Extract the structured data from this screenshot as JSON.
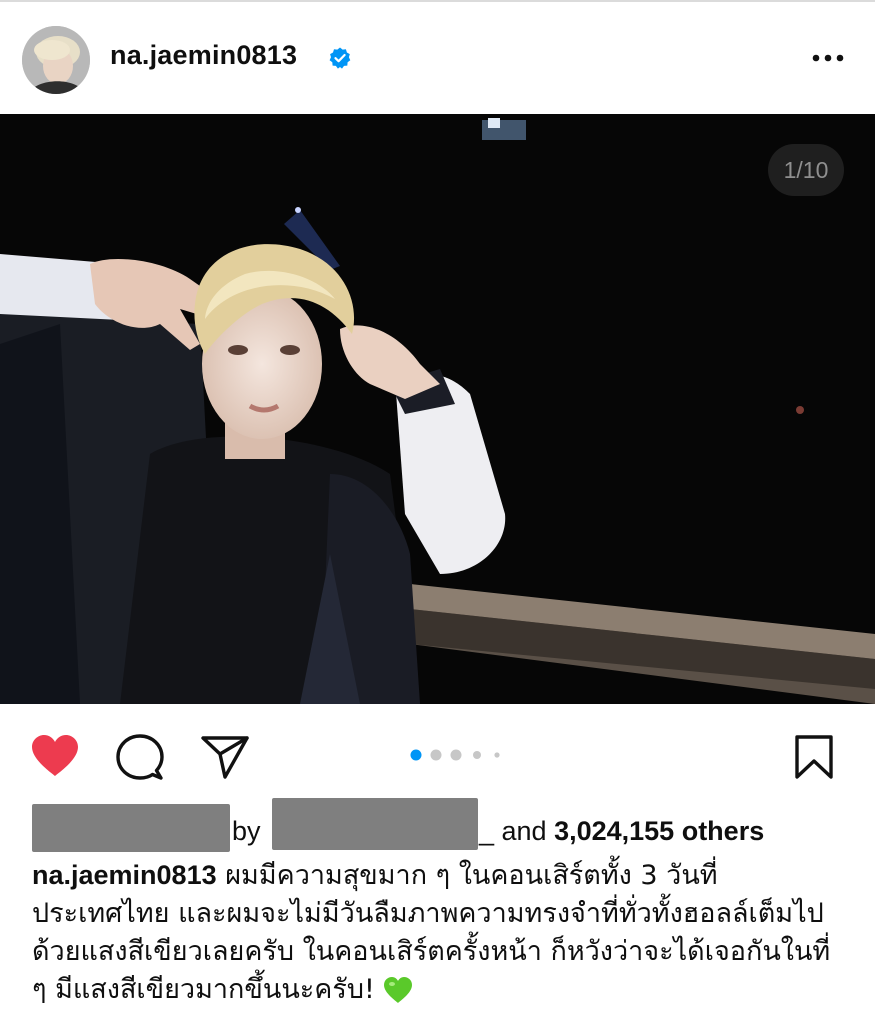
{
  "post": {
    "username": "na.jaemin0813",
    "verified": true,
    "image_counter": "1/10",
    "carousel": {
      "total_dots_visible": 5,
      "active_index": 0
    },
    "liked": true,
    "likes": {
      "prefix_visible_fragment": "by",
      "connector": "_ and ",
      "count_text": "3,024,155 others"
    },
    "caption": {
      "user": "na.jaemin0813",
      "text": "ผมมีความสุขมาก ๆ ในคอนเสิร์ตทั้ง 3 วันที่ประเทศไทย และผมจะไม่มีวันลืมภาพความทรงจำที่ทั่วทั้งฮอลล์เต็มไปด้วยแสงสีเขียวเลยครับ ในคอนเสิร์ตครั้งหน้า ก็หวังว่าจะได้เจอกันในที่ ๆ มีแสงสีเขียวมากขึ้นนะครับ!"
    }
  },
  "icons": {
    "verified": "verified-badge-icon",
    "more": "more-options-icon",
    "like": "heart-icon",
    "comment": "comment-icon",
    "share": "paper-plane-icon",
    "save": "bookmark-icon",
    "caption_emoji": "green-heart-icon"
  },
  "colors": {
    "like_red": "#ed3b4f",
    "verified_blue": "#0095f6",
    "dot_active": "#0095f6",
    "dot_inactive": "#c7c7c7",
    "emoji_green": "#5ac92a"
  }
}
